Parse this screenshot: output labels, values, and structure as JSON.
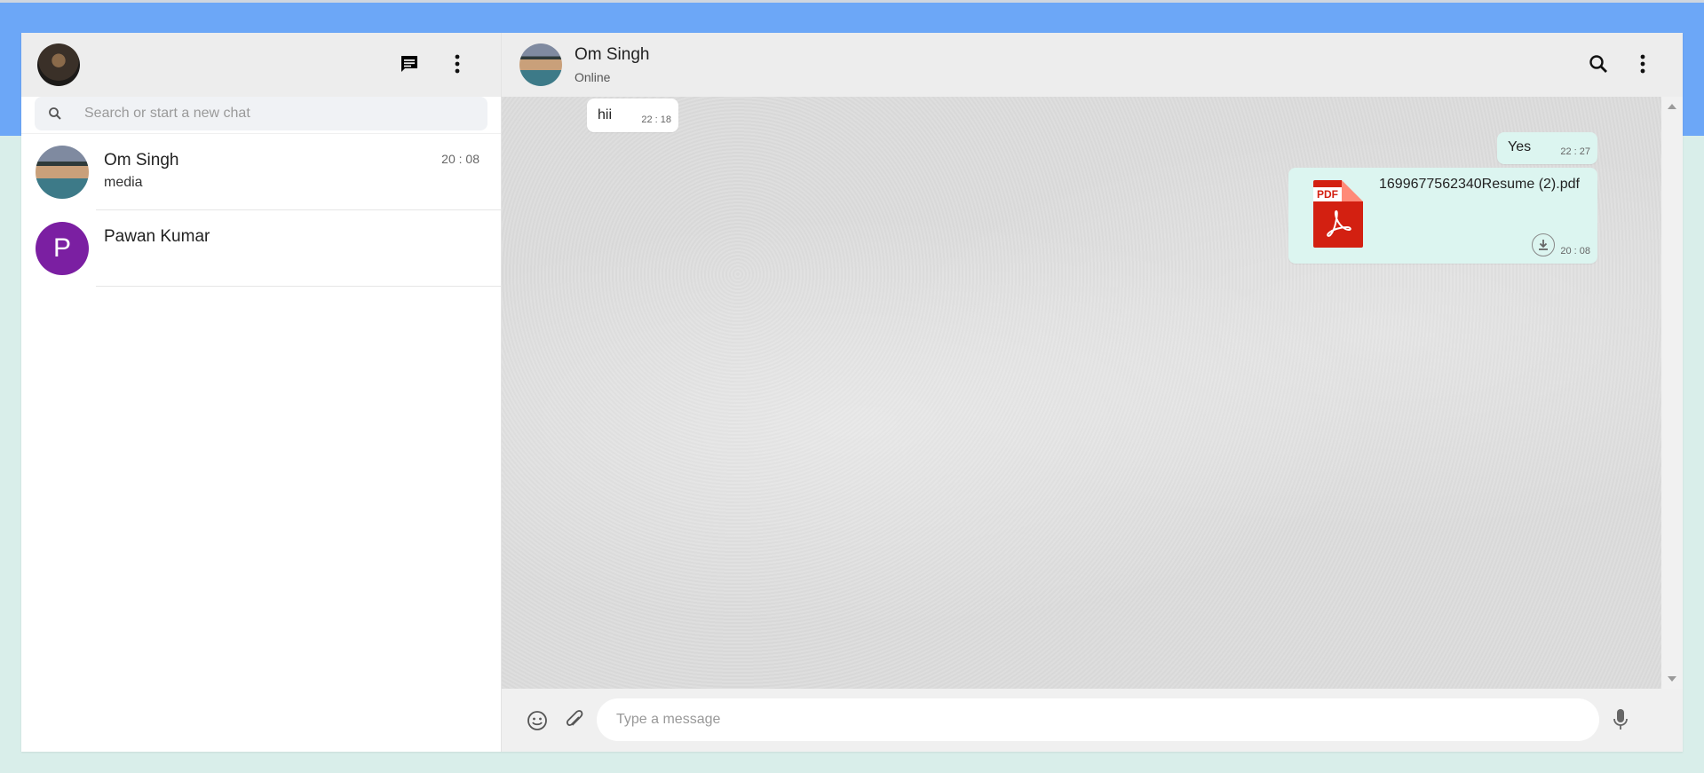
{
  "sidebar": {
    "search": {
      "placeholder": "Search or start a new chat"
    },
    "chats": [
      {
        "name": "Om Singh",
        "last_message": "media",
        "time": "20 : 08",
        "avatar": "photo"
      },
      {
        "name": "Pawan Kumar",
        "last_message": "",
        "time": "",
        "avatar_letter": "P"
      }
    ]
  },
  "conversation": {
    "contact_name": "Om Singh",
    "status": "Online",
    "messages": [
      {
        "direction": "incoming",
        "text": "hii",
        "time": "22 : 18"
      },
      {
        "direction": "outgoing",
        "text": "Yes",
        "time": "22 : 27"
      },
      {
        "direction": "outgoing",
        "type": "file",
        "file_badge": "PDF",
        "file_name": "1699677562340Resume (2).pdf",
        "time": "20 : 08"
      }
    ]
  },
  "composer": {
    "placeholder": "Type a message"
  },
  "colors": {
    "top_band": "#6ca7f7",
    "background": "#d9eeea",
    "outgoing_bubble": "#dcf5f0",
    "incoming_bubble": "#ffffff",
    "avatar_letter_bg": "#7b1fa2",
    "pdf_red": "#d32011"
  },
  "icons": [
    "new-chat-icon",
    "menu-dots-icon",
    "search-icon",
    "emoji-icon",
    "attach-icon",
    "mic-icon",
    "download-icon",
    "pdf-icon"
  ]
}
